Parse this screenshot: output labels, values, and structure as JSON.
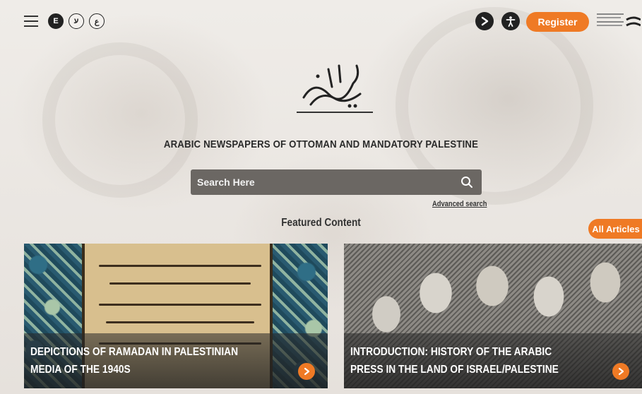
{
  "header": {
    "languages": [
      {
        "label": "E",
        "active": true
      },
      {
        "label": "ע",
        "active": false
      },
      {
        "label": "ع",
        "active": false
      }
    ],
    "register_label": "Register",
    "nli_logo_lines": [
      "הספרייה הלאומית",
      "المكتبة الوطنية الإسرائيلية",
      "THE NATIONAL",
      "LIBRARY OF ISRAEL"
    ]
  },
  "hero": {
    "logo_text": "جرايد",
    "subtitle": "ARABIC NEWSPAPERS OF OTTOMAN AND MANDATORY PALESTINE"
  },
  "search": {
    "placeholder": "Search Here",
    "advanced_label": "Advanced search"
  },
  "featured": {
    "heading": "Featured Content",
    "all_articles_label": "All Articles",
    "cards": [
      {
        "title": "DEPICTIONS OF RAMADAN IN PALESTINIAN MEDIA OF THE 1940S"
      },
      {
        "title": "INTRODUCTION: HISTORY OF THE ARABIC PRESS IN THE LAND OF ISRAEL/PALESTINE"
      }
    ]
  },
  "colors": {
    "accent": "#ef7a25",
    "search_bg": "#6b6763",
    "text_dark": "#2b2b2b"
  },
  "icons": [
    "menu-icon",
    "share-icon",
    "accessibility-icon",
    "search-icon",
    "arrow-right-icon"
  ]
}
